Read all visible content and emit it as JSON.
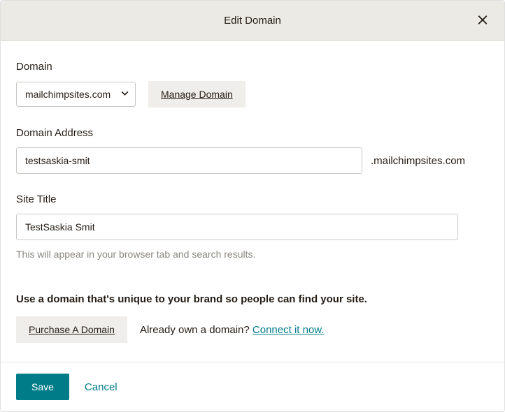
{
  "header": {
    "title": "Edit Domain"
  },
  "domain": {
    "label": "Domain",
    "selected": "mailchimpsites.com",
    "manage_label": "Manage Domain"
  },
  "address": {
    "label": "Domain Address",
    "value": "testsaskia-smit",
    "suffix": ".mailchimpsites.com"
  },
  "site_title": {
    "label": "Site Title",
    "value": "TestSaskia Smit",
    "help_text": "This will appear in your browser tab and search results."
  },
  "promo": {
    "heading": "Use a domain that's unique to your brand so people can find your site.",
    "purchase_label": "Purchase A Domain",
    "already_own_text": "Already own a domain? ",
    "connect_link": "Connect it now."
  },
  "footer": {
    "save_label": "Save",
    "cancel_label": "Cancel"
  }
}
